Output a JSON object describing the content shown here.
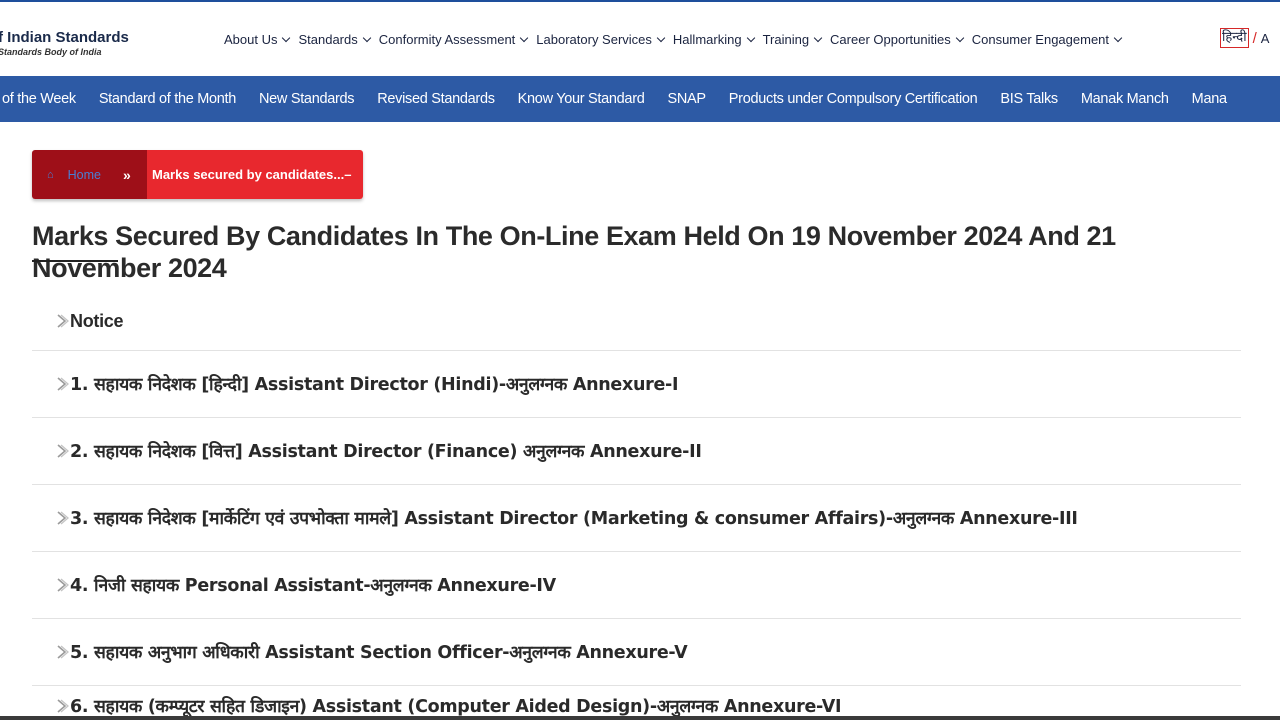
{
  "header": {
    "logo_title": "f Indian Standards",
    "logo_subtitle": "Standards Body of India",
    "nav": [
      {
        "label": "About Us"
      },
      {
        "label": "Standards"
      },
      {
        "label": "Conformity Assessment"
      },
      {
        "label": "Laboratory Services"
      },
      {
        "label": "Hallmarking"
      },
      {
        "label": "Training"
      },
      {
        "label": "Career Opportunities"
      },
      {
        "label": "Consumer Engagement"
      }
    ],
    "lang_hindi": "हिन्दी",
    "lang_separator": "/",
    "lang_english": "A"
  },
  "subnav": {
    "items": [
      {
        "label": "of the Week"
      },
      {
        "label": "Standard of the Month"
      },
      {
        "label": "New Standards"
      },
      {
        "label": "Revised Standards"
      },
      {
        "label": "Know Your Standard"
      },
      {
        "label": "SNAP"
      },
      {
        "label": "Products under Compulsory Certification"
      },
      {
        "label": "BIS Talks"
      },
      {
        "label": "Manak Manch"
      },
      {
        "label": "Mana"
      }
    ]
  },
  "breadcrumb": {
    "home": "Home",
    "separator": "»",
    "current": "Marks secured by candidates...–"
  },
  "page": {
    "title": "Marks Secured By Candidates In The On-Line Exam Held On 19 November 2024 And 21 November 2024"
  },
  "list": {
    "items": [
      {
        "text": "Notice"
      },
      {
        "text": "1. सहायक निदेशक [हिन्दी] Assistant Director (Hindi)-अनुलग्नक Annexure-I"
      },
      {
        "text": "2. सहायक निदेशक [वित्त] Assistant Director (Finance) अनुलग्नक Annexure-II"
      },
      {
        "text": "3. सहायक निदेशक [मार्केटिंग एवं उपभोक्ता मामले] Assistant Director (Marketing & consumer Affairs)-अनुलग्नक Annexure-III"
      },
      {
        "text": "4. निजी सहायक Personal Assistant-अनुलग्नक Annexure-IV"
      },
      {
        "text": "5. सहायक अनुभाग अधिकारी Assistant Section Officer-अनुलग्नक Annexure-V"
      },
      {
        "text": "6. सहायक (कम्प्यूटर सहित डिजाइन) Assistant (Computer Aided Design)-अनुलग्नक Annexure-VI"
      }
    ]
  },
  "colors": {
    "subnav_bg": "#2d5aa5",
    "breadcrumb_home_bg": "#9e0f18",
    "breadcrumb_current_bg": "#e8282e",
    "lang_border": "#d62828"
  }
}
